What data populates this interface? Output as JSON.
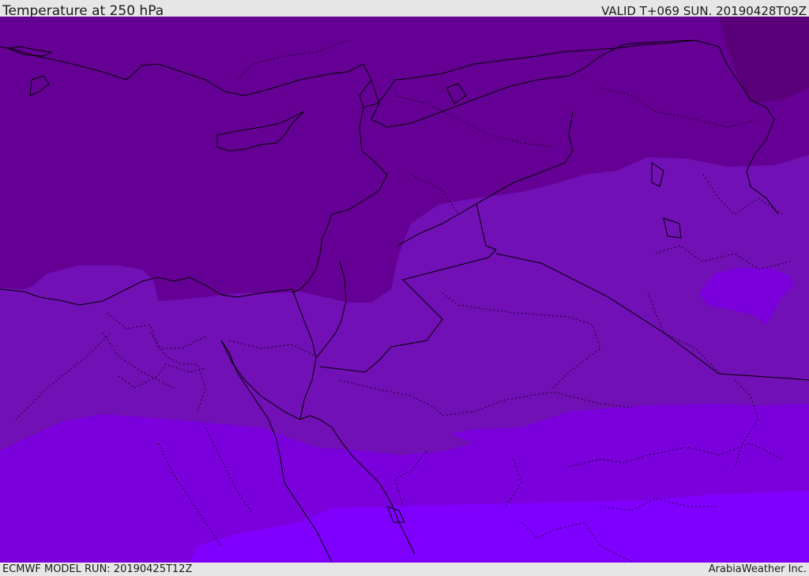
{
  "header": {
    "title": "Temperature at 250 hPa",
    "valid_time": "VALID T+069 SUN. 20190428T09Z"
  },
  "footer": {
    "model_run": "ECMWF MODEL RUN: 20190425T12Z",
    "credit": "ArabiaWeather Inc."
  },
  "map": {
    "variable": "temperature",
    "pressure_level": "250 hPa",
    "region": "Eastern Mediterranean / Middle East",
    "fill_colors": {
      "darkest": "#590078",
      "very_dark": "#650094",
      "dark": "#7110b4",
      "medium": "#7a00dc",
      "bright": "#8000ff"
    },
    "coastline_color": "#000000",
    "border_style": "dotted"
  }
}
